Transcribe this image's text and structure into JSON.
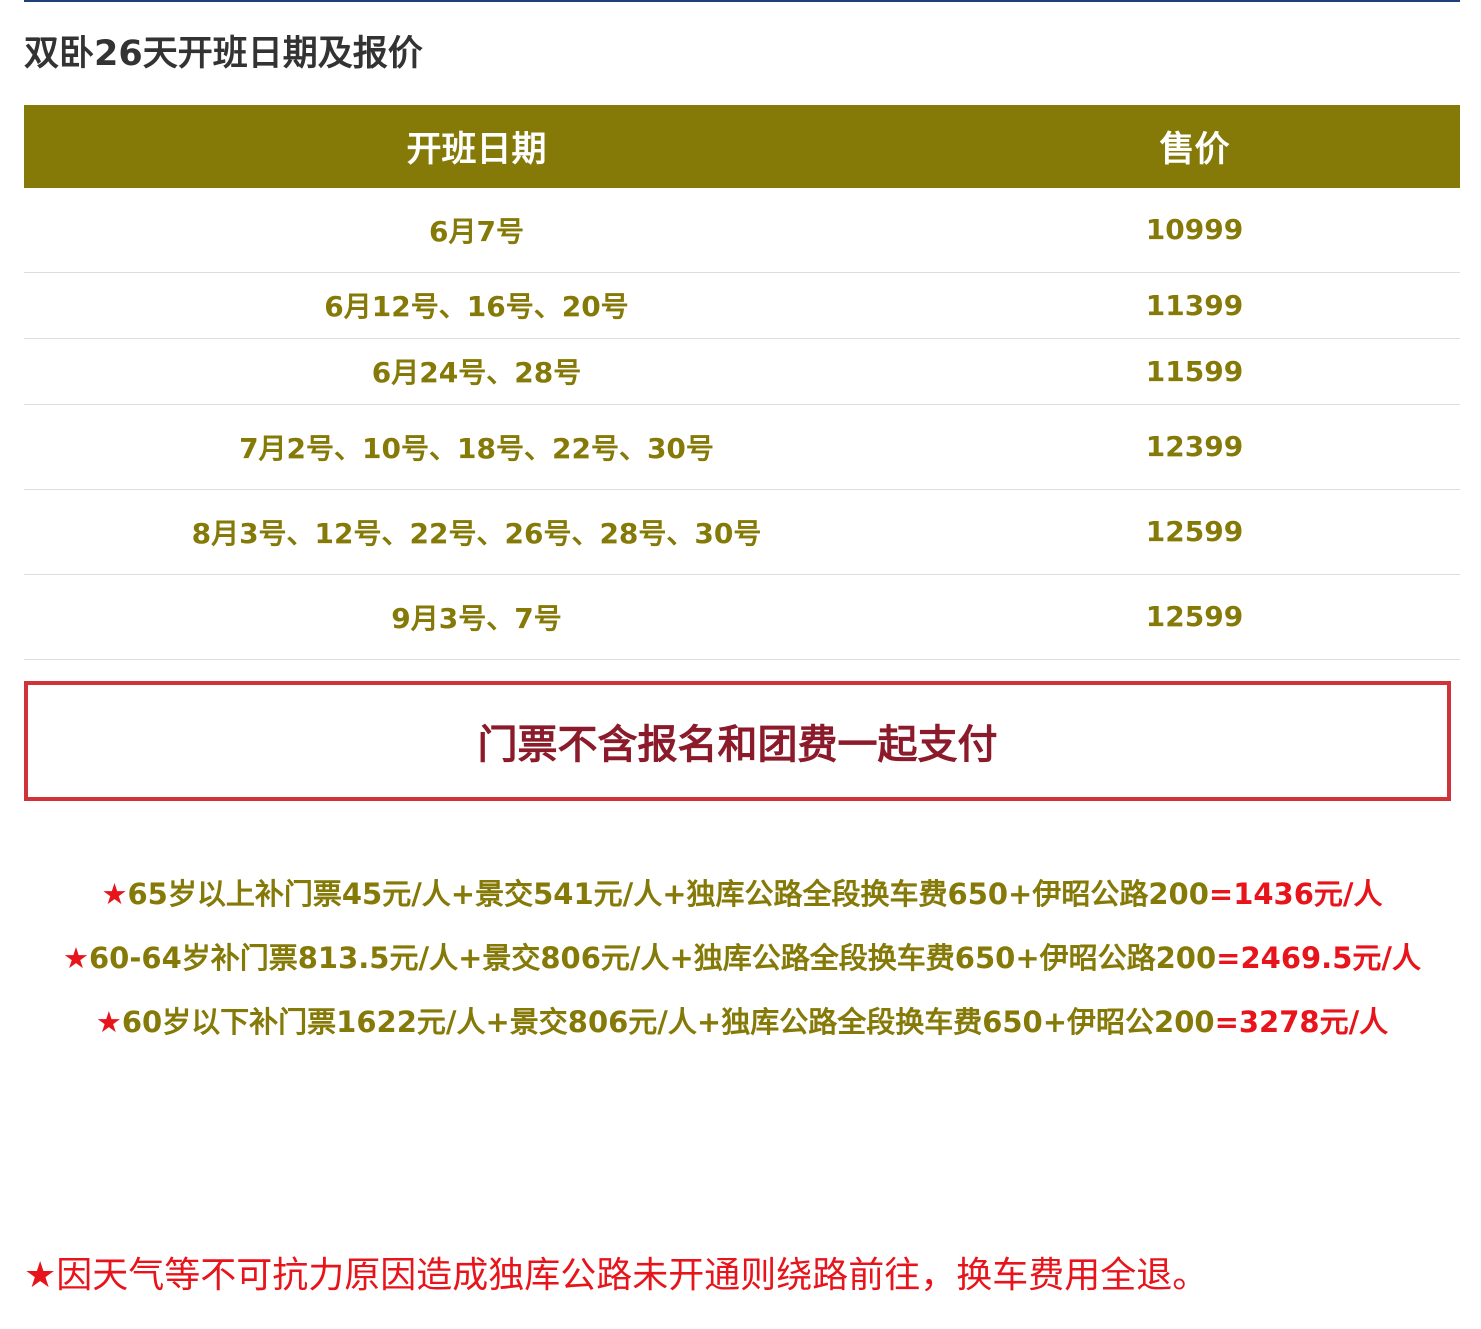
{
  "page": {
    "title": "双卧26天开班日期及报价"
  },
  "table": {
    "headers": [
      "开班日期",
      "售价"
    ],
    "rows": [
      {
        "date": "6月7号",
        "price": "10999"
      },
      {
        "date": "6月12号、16号、20号",
        "price": "11399"
      },
      {
        "date": "6月24号、28号",
        "price": "11599"
      },
      {
        "date": "7月2号、10号、18号、22号、30号",
        "price": "12399"
      },
      {
        "date": "8月3号、12号、22号、26号、28号、30号",
        "price": "12599"
      },
      {
        "date": "9月3号、7号",
        "price": "12599"
      }
    ]
  },
  "notice": {
    "text": "门票不含报名和团费一起支付"
  },
  "fees": [
    {
      "star": "★",
      "text": "65岁以上补门票45元/人+景交541元/人+独库公路全段换车费650+伊昭公路200",
      "total": "=1436元/人"
    },
    {
      "star": "★",
      "text": "60-64岁补门票813.5元/人+景交806元/人+独库公路全段换车费650+伊昭公路200",
      "total": "=2469.5元/人"
    },
    {
      "star": "★",
      "text": "60岁以下补门票1622元/人+景交806元/人+独库公路全段换车费650+伊昭公200",
      "total": "=3278元/人"
    }
  ],
  "footer_note": "★因天气等不可抗力原因造成独库公路未开通则绕路前往，换车费用全退。",
  "colors": {
    "header_bg": "#857908",
    "text_olive": "#857908",
    "accent_red": "#e8141b",
    "notice_border": "#d0343a",
    "notice_text": "#8b1a2a"
  }
}
